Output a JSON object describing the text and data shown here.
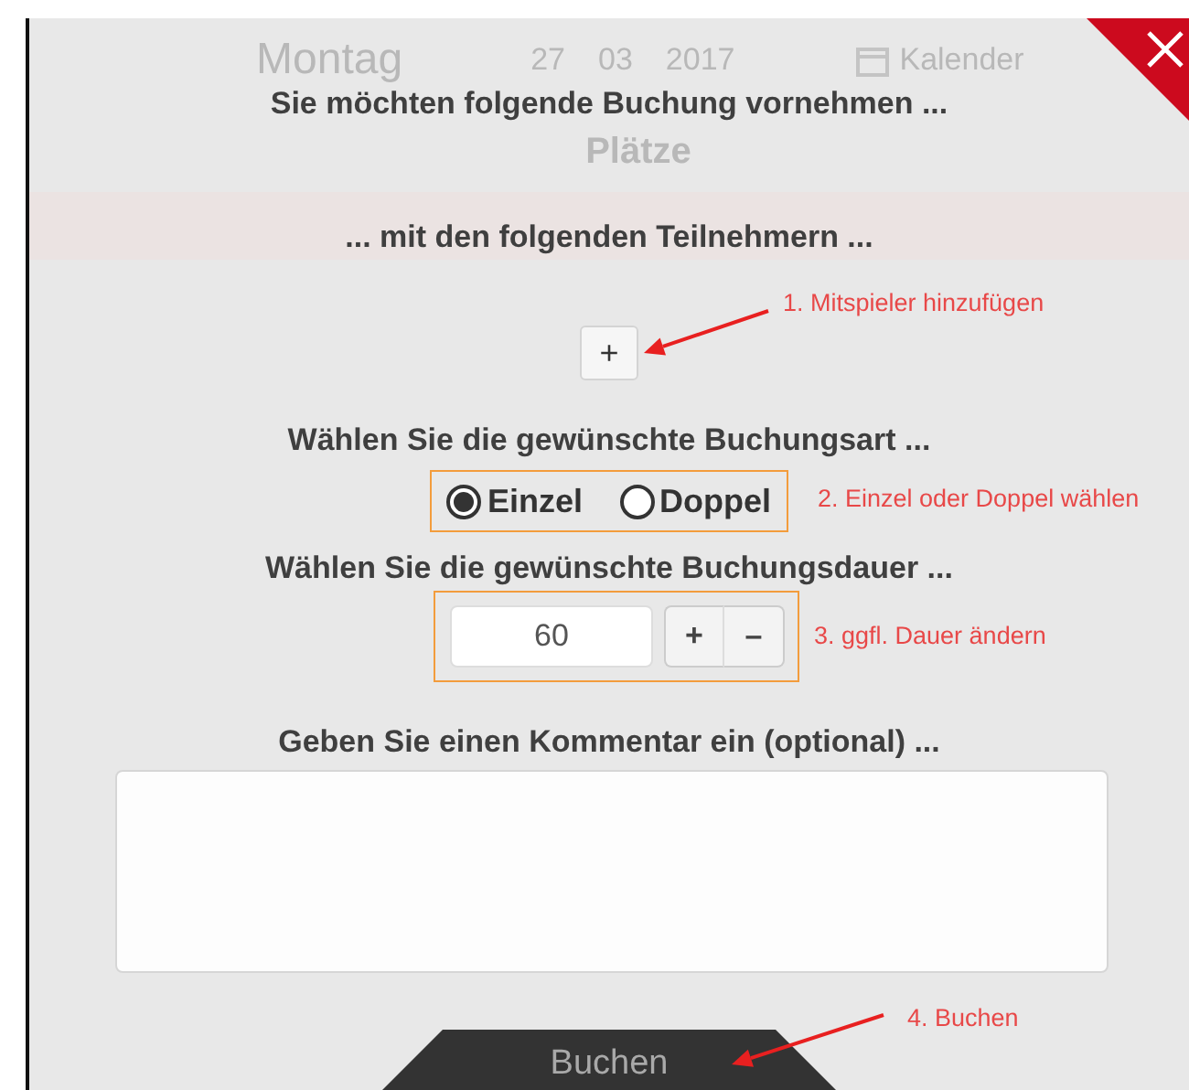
{
  "background": {
    "day": "Montag",
    "date": [
      "27",
      "03",
      "2017"
    ],
    "calendar_link": "Kalender",
    "section": "Plätze"
  },
  "dialog": {
    "title": "Sie möchten folgende Buchung vornehmen ...",
    "participants_heading": "... mit den folgenden Teilnehmern ...",
    "add_player_button": "+",
    "type_heading": "Wählen Sie die gewünschte Buchungsart ...",
    "types": [
      {
        "label": "Einzel",
        "selected": true
      },
      {
        "label": "Doppel",
        "selected": false
      }
    ],
    "duration_heading": "Wählen Sie die gewünschte Buchungsdauer ...",
    "duration": {
      "value": "60",
      "increase": "+",
      "decrease": "–"
    },
    "comment_heading": "Geben Sie einen Kommentar ein (optional) ...",
    "submit": "Buchen"
  },
  "annotations": [
    {
      "text": "1. Mitspieler hinzufügen"
    },
    {
      "text": "2. Einzel oder Doppel wählen"
    },
    {
      "text": "3. ggfl. Dauer ändern"
    },
    {
      "text": "4. Buchen"
    }
  ]
}
